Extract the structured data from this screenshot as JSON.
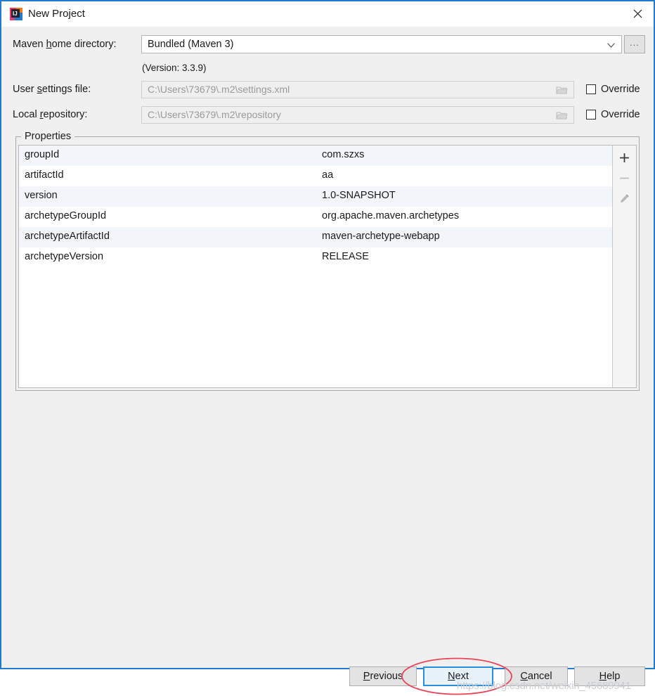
{
  "window": {
    "title": "New Project",
    "app_icon": "intellij-idea-icon",
    "close_icon": "close-icon",
    "border_color": "#1e7bd0"
  },
  "form": {
    "maven_home": {
      "label_pre": "Maven ",
      "label_accel": "h",
      "label_post": "ome directory:",
      "label_full": "Maven home directory:",
      "value": "Bundled (Maven 3)",
      "dropdown_icon": "chevron-down-icon",
      "browse_label": "...",
      "browse_icon": "ellipsis-icon"
    },
    "version_note": "(Version: 3.3.9)",
    "user_settings": {
      "label_pre": "User ",
      "label_accel": "s",
      "label_post": "ettings file:",
      "label_full": "User settings file:",
      "value": "C:\\Users\\73679\\.m2\\settings.xml",
      "browse_icon": "folder-icon",
      "override_label": "Override",
      "override_checked": false
    },
    "local_repository": {
      "label_pre": "Local ",
      "label_accel": "r",
      "label_post": "epository:",
      "label_full": "Local repository:",
      "value": "C:\\Users\\73679\\.m2\\repository",
      "browse_icon": "folder-icon",
      "override_label": "Override",
      "override_checked": false
    }
  },
  "properties": {
    "legend": "Properties",
    "rows": [
      {
        "key": "groupId",
        "value": "com.szxs"
      },
      {
        "key": "artifactId",
        "value": "aa"
      },
      {
        "key": "version",
        "value": "1.0-SNAPSHOT"
      },
      {
        "key": "archetypeGroupId",
        "value": "org.apache.maven.archetypes"
      },
      {
        "key": "archetypeArtifactId",
        "value": "maven-archetype-webapp"
      },
      {
        "key": "archetypeVersion",
        "value": "RELEASE"
      }
    ],
    "toolbar": {
      "add_icon": "plus-icon",
      "remove_icon": "minus-icon",
      "edit_icon": "pencil-icon"
    }
  },
  "buttons": {
    "previous": {
      "pre": "",
      "accel": "P",
      "post": "revious",
      "full": "Previous"
    },
    "next": {
      "pre": "",
      "accel": "N",
      "post": "ext",
      "full": "Next"
    },
    "cancel": {
      "pre": "",
      "accel": "C",
      "post": "ancel",
      "full": "Cancel"
    },
    "help": {
      "pre": "",
      "accel": "H",
      "post": "elp",
      "full": "Help"
    }
  },
  "annotation": {
    "shape": "red-ellipse-highlight",
    "color": "#e8455a",
    "target": "Next"
  },
  "watermark": {
    "text": "https://blog.csdn.net/weixin_45689941"
  }
}
